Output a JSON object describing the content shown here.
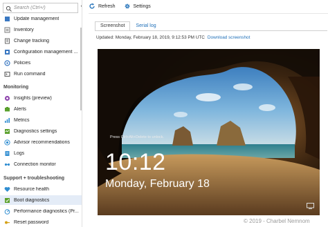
{
  "sidebar": {
    "search_placeholder": "Search (Ctrl+/)",
    "collapse_glyph": "«",
    "items_top": [
      {
        "label": "Update management",
        "icon": "update-icon",
        "color": "#3a78c2"
      },
      {
        "label": "Inventory",
        "icon": "inventory-icon",
        "color": "#7a7a7a"
      },
      {
        "label": "Change tracking",
        "icon": "change-tracking-icon",
        "color": "#6a6a6a"
      },
      {
        "label": "Configuration management ...",
        "icon": "configuration-icon",
        "color": "#3a78c2"
      },
      {
        "label": "Policies",
        "icon": "policies-icon",
        "color": "#3a78c2"
      },
      {
        "label": "Run command",
        "icon": "run-command-icon",
        "color": "#555555"
      }
    ],
    "monitoring_title": "Monitoring",
    "monitoring_items": [
      {
        "label": "Insights (preview)",
        "icon": "insights-icon",
        "color": "#8e44ad"
      },
      {
        "label": "Alerts",
        "icon": "alerts-icon",
        "color": "#5aa02c"
      },
      {
        "label": "Metrics",
        "icon": "metrics-icon",
        "color": "#2f8dd1"
      },
      {
        "label": "Diagnostics settings",
        "icon": "diagnostics-settings-icon",
        "color": "#5aa02c"
      },
      {
        "label": "Advisor recommendations",
        "icon": "advisor-icon",
        "color": "#2f8dd1"
      },
      {
        "label": "Logs",
        "icon": "logs-icon",
        "color": "#2f8dd1"
      },
      {
        "label": "Connection monitor",
        "icon": "connection-monitor-icon",
        "color": "#2f8dd1"
      }
    ],
    "support_title": "Support + troubleshooting",
    "support_items": [
      {
        "label": "Resource health",
        "icon": "resource-health-icon",
        "color": "#2f8dd1",
        "selected": false
      },
      {
        "label": "Boot diagnostics",
        "icon": "boot-diagnostics-icon",
        "color": "#5aa02c",
        "selected": true
      },
      {
        "label": "Performance diagnostics (Pr...",
        "icon": "performance-diagnostics-icon",
        "color": "#2f8dd1",
        "selected": false
      },
      {
        "label": "Reset password",
        "icon": "reset-password-icon",
        "color": "#d4a017",
        "selected": false
      }
    ]
  },
  "toolbar": {
    "refresh_label": "Refresh",
    "settings_label": "Settings",
    "accent": "#1f6fb8"
  },
  "tabs": [
    {
      "label": "Screenshot",
      "active": true
    },
    {
      "label": "Serial log",
      "active": false
    }
  ],
  "updated": {
    "text": "Updated: Monday, February 18, 2019, 9:12:53 PM UTC",
    "download_label": "Download screenshot"
  },
  "lockscreen": {
    "unlock_hint": "Press Ctrl+Alt+Delete to unlock.",
    "time": "10:12",
    "date": "Monday, February 18"
  },
  "copyright": "© 2019 - Charbel Nemnom"
}
